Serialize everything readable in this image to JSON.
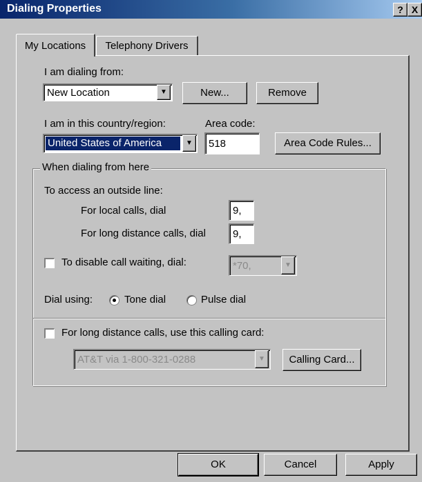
{
  "window": {
    "title": "Dialing Properties",
    "help_glyph": "?",
    "close_glyph": "X"
  },
  "tabs": [
    {
      "label": "My Locations"
    },
    {
      "label": "Telephony Drivers"
    }
  ],
  "location": {
    "label": "I am dialing from:",
    "value": "New Location",
    "new_button": "New...",
    "remove_button": "Remove"
  },
  "country": {
    "label": "I am in this country/region:",
    "value": "United States of America",
    "area_code_label": "Area code:",
    "area_code_value": "518",
    "area_code_rules_button": "Area Code Rules..."
  },
  "dialing_group": {
    "title": "When dialing from here",
    "outside_line_label": "To access an outside line:",
    "local_label": "For local calls, dial",
    "local_value": "9,",
    "long_distance_label": "For long distance calls, dial",
    "long_distance_value": "9,",
    "call_waiting_label": "To disable call waiting, dial:",
    "call_waiting_value": "*70,",
    "dial_using_label": "Dial using:",
    "tone_label": "Tone dial",
    "pulse_label": "Pulse dial",
    "calling_card_label": "For long distance calls, use this calling card:",
    "calling_card_value": "AT&T via 1-800-321-0288",
    "calling_card_button": "Calling Card..."
  },
  "footer": {
    "ok": "OK",
    "cancel": "Cancel",
    "apply": "Apply"
  },
  "arrow_glyph": "▼"
}
